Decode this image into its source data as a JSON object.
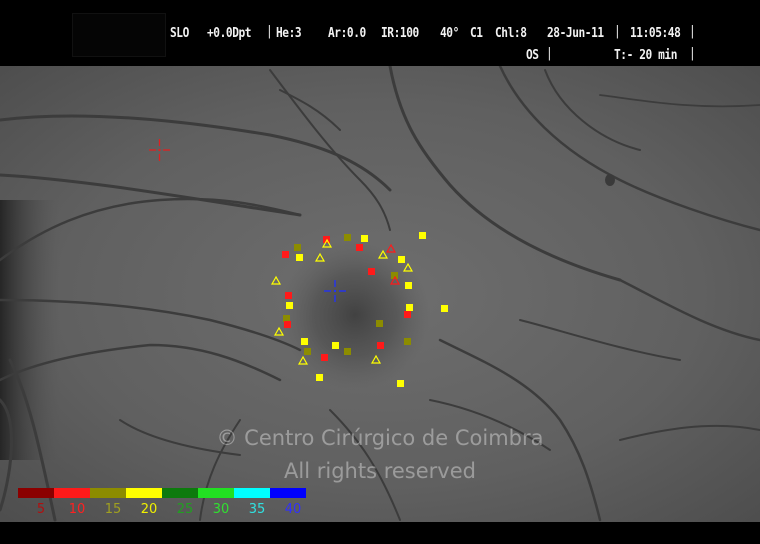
{
  "header": {
    "mode": "SLO",
    "focus": "+0.0Dpt",
    "he": "He:3",
    "ar": "Ar:0.0",
    "ir": "IR:100",
    "fov": "40°",
    "c": "C1",
    "ch": "Chl:8",
    "date": "28-Jun-11",
    "time": "11:05:48",
    "eye": "OS",
    "duration": "T:- 20 min"
  },
  "watermark": {
    "line1": "© Centro Cirúrgico de Coimbra",
    "line2": "All rights reserved"
  },
  "scale": [
    {
      "label": "5",
      "color": "#8b0000",
      "text_color": "#b01010"
    },
    {
      "label": "10",
      "color": "#ff1a1a",
      "text_color": "#ff2020"
    },
    {
      "label": "15",
      "color": "#8c8c00",
      "text_color": "#a0a020"
    },
    {
      "label": "20",
      "color": "#ffff00",
      "text_color": "#f0f000"
    },
    {
      "label": "25",
      "color": "#0d7a0d",
      "text_color": "#20a020"
    },
    {
      "label": "30",
      "color": "#22e022",
      "text_color": "#30e030"
    },
    {
      "label": "35",
      "color": "#00ffff",
      "text_color": "#30e0e0"
    },
    {
      "label": "40",
      "color": "#0000ff",
      "text_color": "#3030ff"
    }
  ],
  "targets": {
    "reference_color": "#e02020",
    "fixation_color": "#2030ff"
  }
}
